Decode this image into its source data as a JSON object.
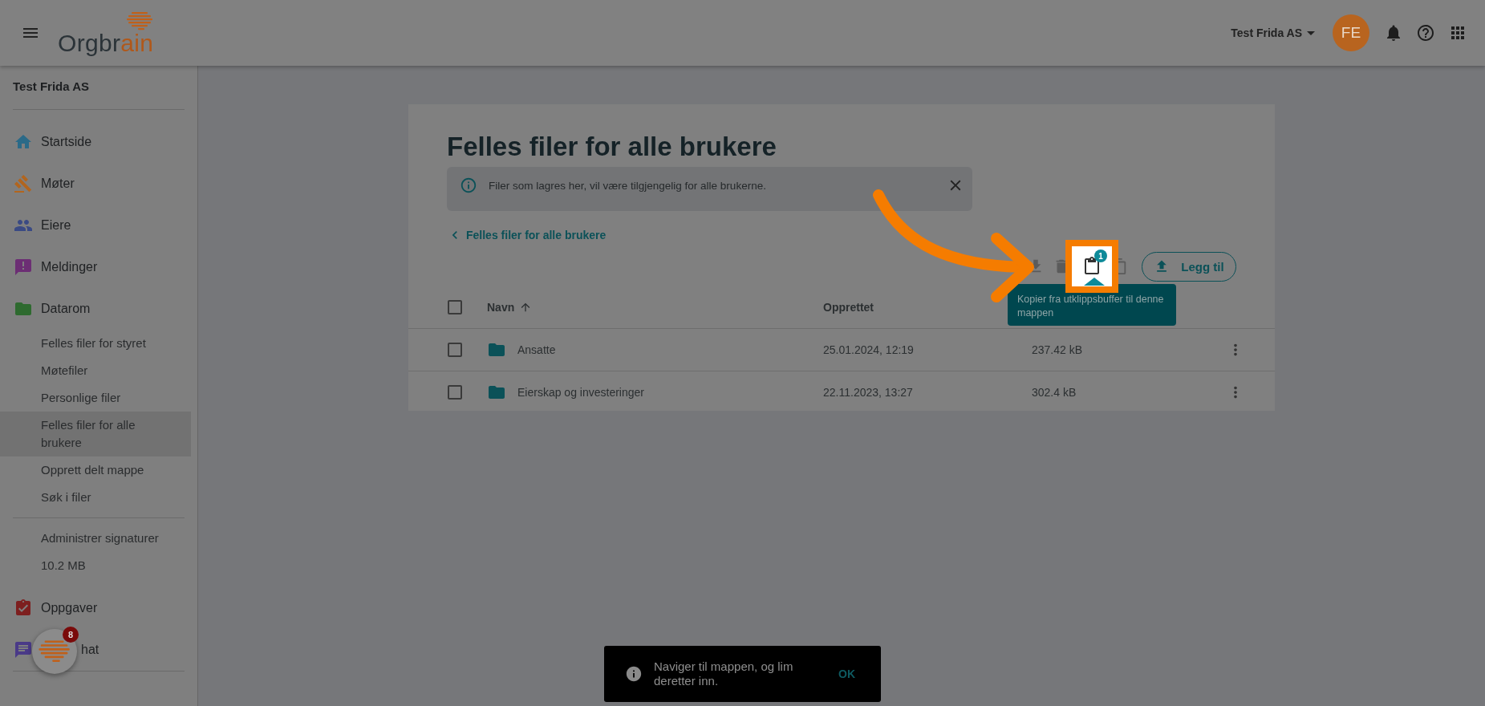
{
  "top_bar": {
    "logo_main": "Orgbr",
    "logo_accent": "ain",
    "org_selector": "Test Frida AS",
    "avatar": "FE"
  },
  "sidebar": {
    "org_name": "Test Frida AS",
    "nav": [
      {
        "label": "Startside"
      },
      {
        "label": "Møter"
      },
      {
        "label": "Eiere"
      },
      {
        "label": "Meldinger"
      },
      {
        "label": "Datarom",
        "children": [
          {
            "label": "Felles filer for styret",
            "selected": false
          },
          {
            "label": "Møtefiler",
            "selected": false
          },
          {
            "label": "Personlige filer",
            "selected": false
          },
          {
            "label": "Felles filer for alle brukere",
            "selected": true
          },
          {
            "label": "Opprett delt mappe",
            "selected": false
          },
          {
            "label": "Søk i filer",
            "selected": false
          }
        ]
      }
    ],
    "extra": [
      {
        "label": "Administrer signaturer"
      },
      {
        "label": "10.2 MB"
      }
    ],
    "nav_bottom": [
      {
        "label": "Oppgaver",
        "kind": "plain"
      },
      {
        "label": "hat",
        "kind": "covered"
      }
    ]
  },
  "chat_bubble": {
    "badge": "8"
  },
  "page": {
    "title": "Felles filer for alle brukere",
    "info": "Filer som lagres her, vil være tilgjengelig for alle brukerne.",
    "breadcrumb": "Felles filer for alle brukere",
    "toolbar": {
      "paste_badge": "1",
      "add_button": "Legg til"
    },
    "tooltip": "Kopier fra utklippsbuffer til denne mappen",
    "table": {
      "select_all": {
        "checked": false
      },
      "columns": [
        "Navn",
        "Opprettet"
      ],
      "rows": [
        {
          "checked": false,
          "name": "Ansatte",
          "created": "25.01.2024, 12:19",
          "size": "237.42 kB"
        },
        {
          "checked": false,
          "name": "Eierskap og investeringer",
          "created": "22.11.2023, 13:27",
          "size": "302.4 kB"
        }
      ]
    }
  },
  "snackbar": {
    "message": "Naviger til mappen, og lim deretter inn.",
    "action": "OK"
  }
}
